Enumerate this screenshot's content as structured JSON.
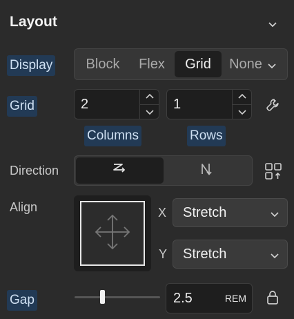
{
  "panel": {
    "title": "Layout",
    "collapse_icon": "chevron-down-icon"
  },
  "display": {
    "label": "Display",
    "options": [
      "Block",
      "Flex",
      "Grid",
      "None"
    ],
    "selected": "Grid"
  },
  "grid": {
    "label": "Grid",
    "columns": {
      "value": "2",
      "label": "Columns"
    },
    "rows": {
      "value": "1",
      "label": "Rows"
    },
    "settings_icon": "wrench-icon"
  },
  "direction": {
    "label": "Direction",
    "options": [
      "row-icon",
      "column-icon"
    ],
    "selected": "row-icon",
    "extra_icon": "grid-auto-flow-icon"
  },
  "align": {
    "label": "Align",
    "x_label": "X",
    "x_value": "Stretch",
    "y_label": "Y",
    "y_value": "Stretch"
  },
  "gap": {
    "label": "Gap",
    "value": "2.5",
    "unit": "REM",
    "lock_icon": "lock-icon"
  },
  "colors": {
    "background": "#2b2b2b",
    "highlight": "#223a55",
    "input_bg": "#1e1e1e"
  }
}
